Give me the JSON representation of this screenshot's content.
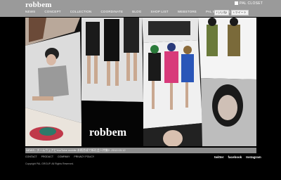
{
  "brand": {
    "logo": "robbem",
    "overlay": "robbem",
    "closet_link": "PAL CLOSET"
  },
  "nav": [
    "NEWS",
    "CONCEPT",
    "COLLECTION",
    "COORDINATE",
    "BLOG",
    "SHOP LIST",
    "WEBSTORE",
    "PAL MAGAZINE"
  ],
  "social_top": [
    {
      "icon": "like-icon",
      "label": "いいね!"
    },
    {
      "icon": "twitter-icon",
      "label": "ツイート"
    }
  ],
  "news": {
    "text": "NEWS : チームウェアとYouTube mobile 本格合成で新社会人特集!! -2012.03.12"
  },
  "footer_nav": [
    "CONTACT",
    "PRODUCT",
    "COMPANY",
    "PRIVACY POLICY"
  ],
  "social_bottom": [
    "twitter",
    "facebook",
    "Instagram"
  ],
  "copyright": "Copyright PAL GROUP. All Rights Reserved.",
  "colors": {
    "topbar": "#9a9a9a",
    "newsbar": "#8f8f8f",
    "background": "#000000"
  }
}
